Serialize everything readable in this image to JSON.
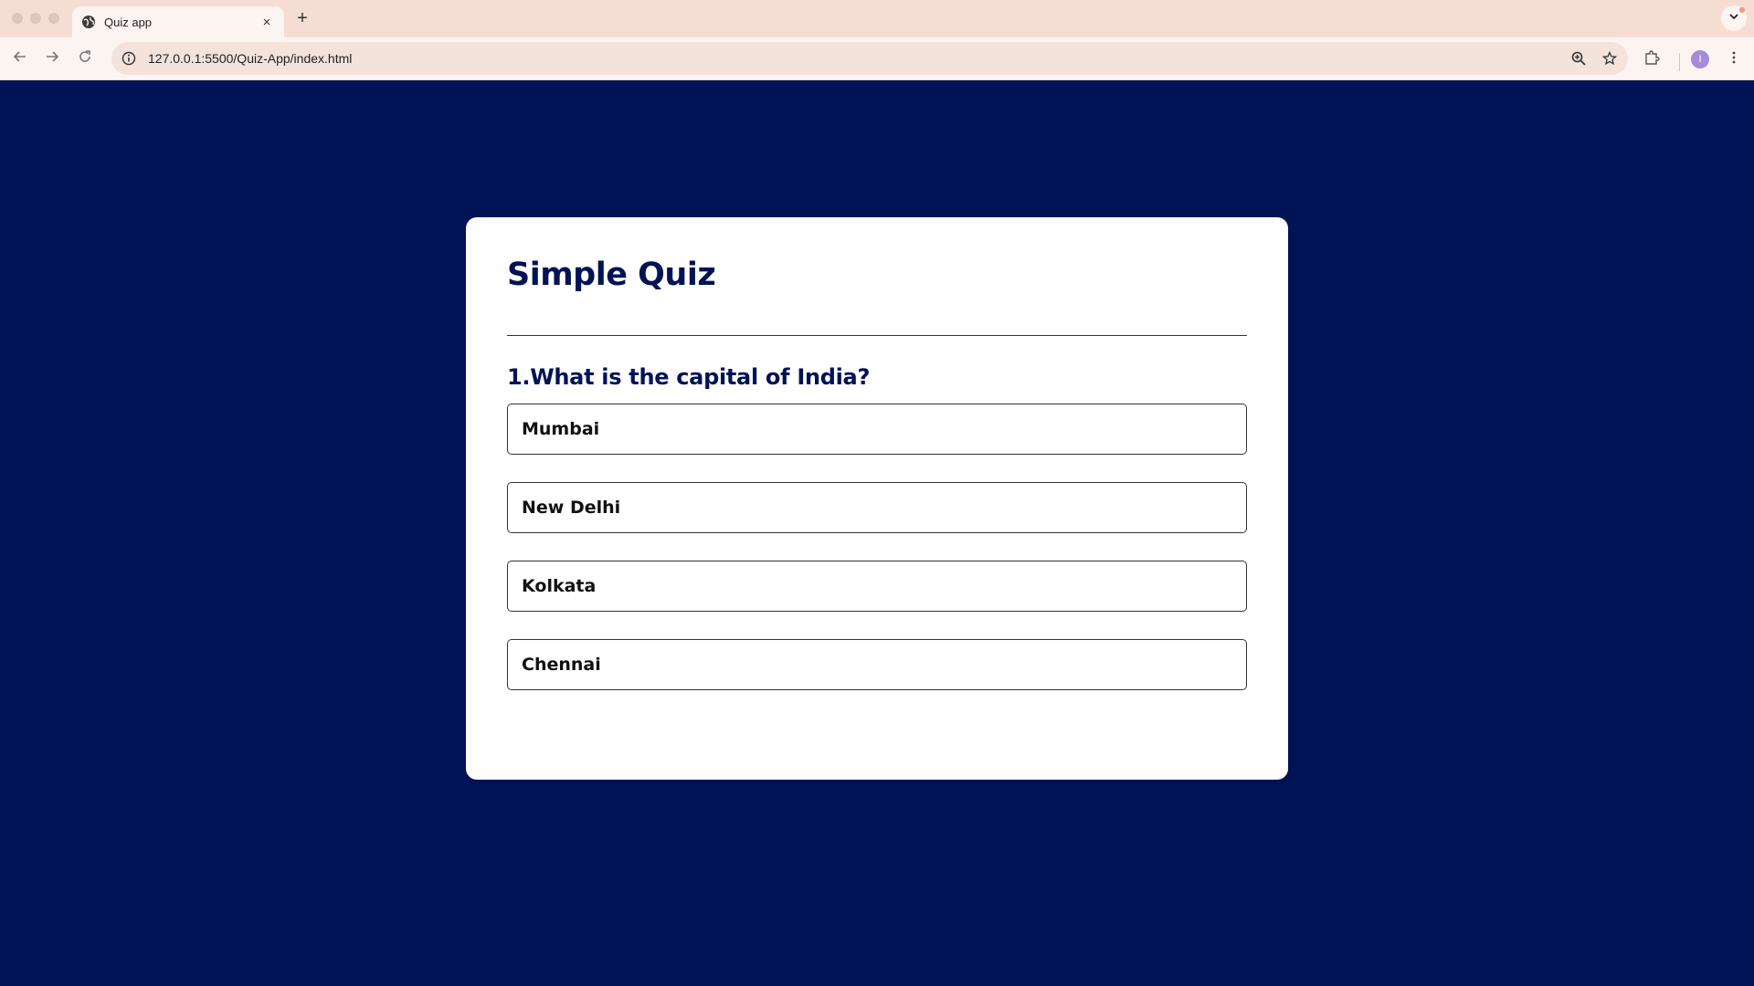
{
  "browser": {
    "tab_title": "Quiz app",
    "tab_close": "×",
    "new_tab": "+",
    "url": "127.0.0.1:5500/Quiz-App/index.html",
    "profile_initial": "I"
  },
  "quiz": {
    "title": "Simple Quiz",
    "question": "1.What is the capital of India?",
    "answers": [
      "Mumbai",
      "New Delhi",
      "Kolkata",
      "Chennai"
    ]
  },
  "colors": {
    "page_background": "#001355",
    "card_background": "#ffffff",
    "heading_text": "#001355",
    "browser_frame": "#f6ddd3"
  },
  "icons": {
    "tab_favicon": "globe-icon",
    "back": "arrow-left-icon",
    "forward": "arrow-right-icon",
    "reload": "reload-icon",
    "site_info": "info-icon",
    "zoom": "zoom-icon",
    "bookmark": "star-icon",
    "extensions": "puzzle-icon",
    "menu": "kebab-menu-icon",
    "tab_search": "chevron-down-icon"
  }
}
